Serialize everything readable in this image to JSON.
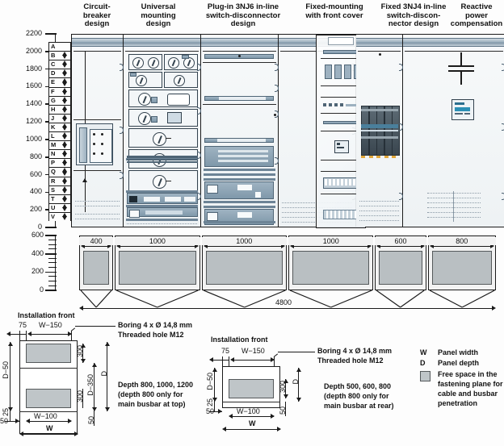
{
  "columns": [
    {
      "title": "Circuit-\nbreaker\ndesign",
      "width_mm": 400
    },
    {
      "title": "Universal\nmounting\ndesign",
      "width_mm": 1000
    },
    {
      "title": "Plug-in 3NJ6 in-line\nswitch-disconnector\ndesign",
      "width_mm": 1000
    },
    {
      "title": "Fixed-mounting\nwith front cover",
      "width_mm": 1000
    },
    {
      "title": "Fixed 3NJ4 in-line\nswitch-discon-\nnector design",
      "width_mm": 600
    },
    {
      "title": "Reactive power\ncompensation",
      "width_mm": 800
    }
  ],
  "elevation_scale": {
    "unit": "mm",
    "ticks": [
      0,
      200,
      400,
      600,
      800,
      1000,
      1200,
      1400,
      1600,
      1800,
      2000,
      2200
    ],
    "letters": [
      "A",
      "B",
      "C",
      "D",
      "E",
      "F",
      "G",
      "H",
      "J",
      "K",
      "L",
      "M",
      "N",
      "P",
      "Q",
      "R",
      "S",
      "T",
      "U",
      "V"
    ]
  },
  "plan_scale": {
    "unit": "mm",
    "ticks": [
      0,
      200,
      400,
      600
    ]
  },
  "plan": {
    "widths": [
      "400",
      "1000",
      "1000",
      "1000",
      "600",
      "800"
    ],
    "total": "4800"
  },
  "detail_left": {
    "installation_front": "Installation front",
    "dim_75": "75",
    "dim_w150": "W−150",
    "dim_d50": "D−50",
    "dim_25": "25",
    "dim_50": "50",
    "dim_300_top": "300",
    "dim_300_bottom": "300",
    "dim_d350": "D−350",
    "dim_d": "D",
    "dim_w100": "W−100",
    "dim_w": "W",
    "dim_50_bottom": "50",
    "boring_line1": "Boring 4 x Ø 14,8 mm",
    "boring_line2": "Threaded hole M12",
    "depth_line1": "Depth 800, 1000, 1200",
    "depth_line2": "(depth 800 only for",
    "depth_line3": "main busbar at top)"
  },
  "detail_right": {
    "installation_front": "Installation front",
    "dim_75": "75",
    "dim_w150": "W−150",
    "dim_d50": "D−50",
    "dim_25": "25",
    "dim_50": "50",
    "dim_300": "300",
    "dim_d": "D",
    "dim_w100": "W−100",
    "dim_w": "W",
    "dim_50_bottom": "50",
    "boring_line1": "Boring 4 x Ø 14,8 mm",
    "boring_line2": "Threaded hole M12",
    "depth_line1": "Depth 500, 600, 800",
    "depth_line2": "(depth 800 only for",
    "depth_line3": "main busbar at rear)"
  },
  "legend": {
    "w_symbol": "W",
    "w_text": "Panel width",
    "d_symbol": "D",
    "d_text": "Panel depth",
    "swatch_line1": "Free space in the",
    "swatch_line2": "fastening plane for",
    "swatch_line3": "cable and busbar",
    "swatch_line4": "penetration"
  },
  "colors": {
    "busbar_blue": "#7e95a6",
    "module_blue": "#8ca4b5",
    "free_space_gray": "#bfc5c8",
    "line_black": "#1b1b1b",
    "panel_bg": "#f4f6f7"
  }
}
